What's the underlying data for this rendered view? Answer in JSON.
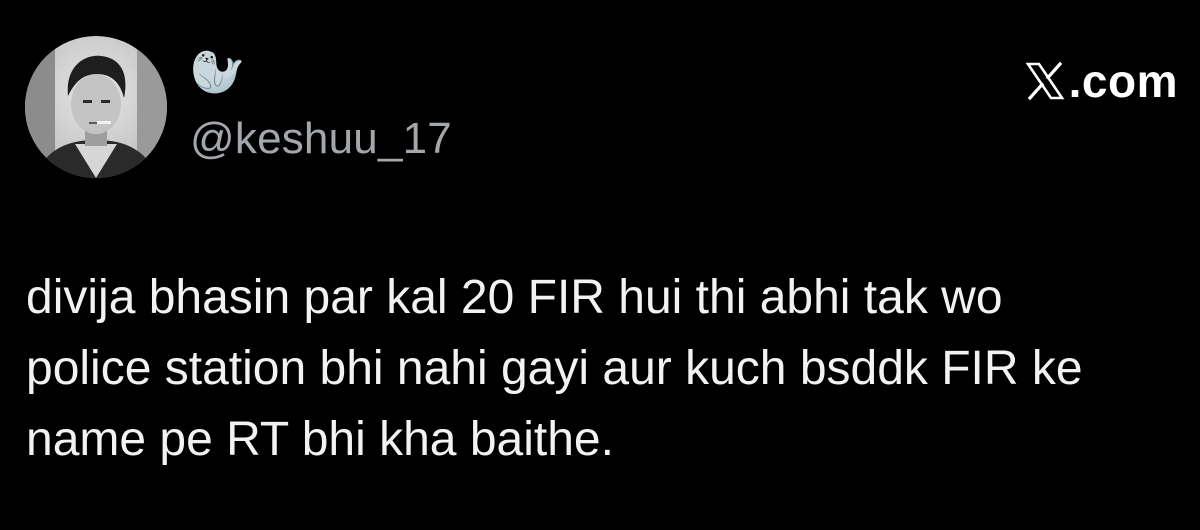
{
  "tweet": {
    "author": {
      "display_name": "🦭",
      "handle": "@keshuu_17",
      "avatar": {
        "icon": "profile-photo-icon",
        "description_colors": [
          "#d9d9d9",
          "#5a5a5a",
          "#1e1e1e"
        ]
      }
    },
    "brand": {
      "icon": "x-logo-icon",
      "text": ".com"
    },
    "text_lines": [
      "divija bhasin par kal 20 FIR hui thi abhi tak wo",
      "police station bhi nahi gayi aur kuch bsddk FIR ke",
      "name pe RT bhi kha baithe."
    ]
  },
  "colors": {
    "background": "#000000",
    "primary_text": "#f2f2f2",
    "secondary_text": "#a3a7ab",
    "brand_text": "#ffffff"
  }
}
